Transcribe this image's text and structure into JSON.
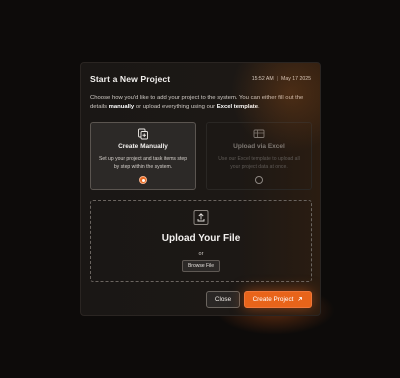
{
  "dialog": {
    "title": "Start a New Project",
    "time": "15:52 AM",
    "date": "May 17 2025",
    "intro_part1": "Choose how you'd like to add your project to the system. You can either fill out the details ",
    "intro_bold1": "manually",
    "intro_part2": " or upload everything using our ",
    "intro_bold2": "Excel template",
    "intro_part3": "."
  },
  "options": {
    "manual": {
      "title": "Create Manually",
      "description": "Set up your project and task items step by step within the system.",
      "icon": "document-add-icon",
      "selected": true
    },
    "excel": {
      "title": "Upload via Excel",
      "description": "Use our Excel template to upload all your project data at once.",
      "icon": "spreadsheet-icon",
      "selected": false
    }
  },
  "upload": {
    "icon": "upload-icon",
    "title": "Upload Your File",
    "or_text": "or",
    "browse_label": "Browse File"
  },
  "footer": {
    "close_label": "Close",
    "create_label": "Create Project",
    "create_icon": "arrow-up-right-icon"
  },
  "colors": {
    "accent": "#e8641a",
    "background": "#0d0b0a",
    "panel": "#1a1715"
  }
}
